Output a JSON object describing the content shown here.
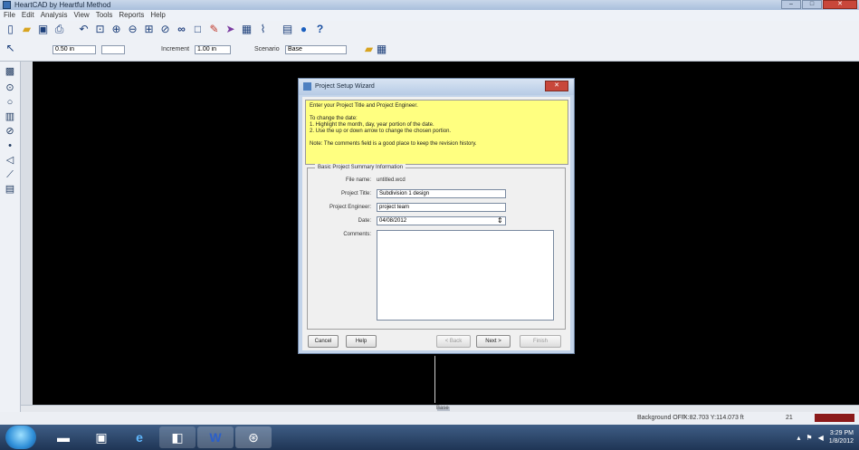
{
  "window": {
    "title": "HeartCAD by Heartful Method"
  },
  "menu": [
    "File",
    "Edit",
    "Analysis",
    "View",
    "Tools",
    "Reports",
    "Help"
  ],
  "toolbar2": {
    "grid_value": "0.50 in",
    "snap_label": "Increment",
    "snap_value": "1.00 in",
    "scenario_label": "Scenario",
    "scenario_value": "Base"
  },
  "status": {
    "left": "Background OFF",
    "coords": "X:82.703 Y:114.073 ft",
    "zoom": "21"
  },
  "taskbar": {
    "time": "3:29 PM",
    "date": "1/8/2012"
  },
  "dialog": {
    "title": "Project Setup Wizard",
    "instructions": [
      "Enter your Project Title and Project Engineer.",
      "",
      "To change the date:",
      "1. Highlight the month, day, year portion of the date.",
      "2. Use the up or down arrow to change the chosen portion.",
      "",
      "Note: The comments field is a good place to keep the revision history."
    ],
    "group_title": "Basic Project Summary Information",
    "filename_label": "File name:",
    "filename_value": "untitled.wcd",
    "project_title_label": "Project Title:",
    "project_title_value": "Subdivision 1 design",
    "engineer_label": "Project Engineer:",
    "engineer_value": "project team",
    "date_label": "Date:",
    "date_value": "04/08/2012",
    "comments_label": "Comments:",
    "buttons": {
      "cancel": "Cancel",
      "help": "Help",
      "back": "< Back",
      "next": "Next >",
      "finish": "Finish"
    }
  },
  "canvas": {
    "label": "Base"
  }
}
